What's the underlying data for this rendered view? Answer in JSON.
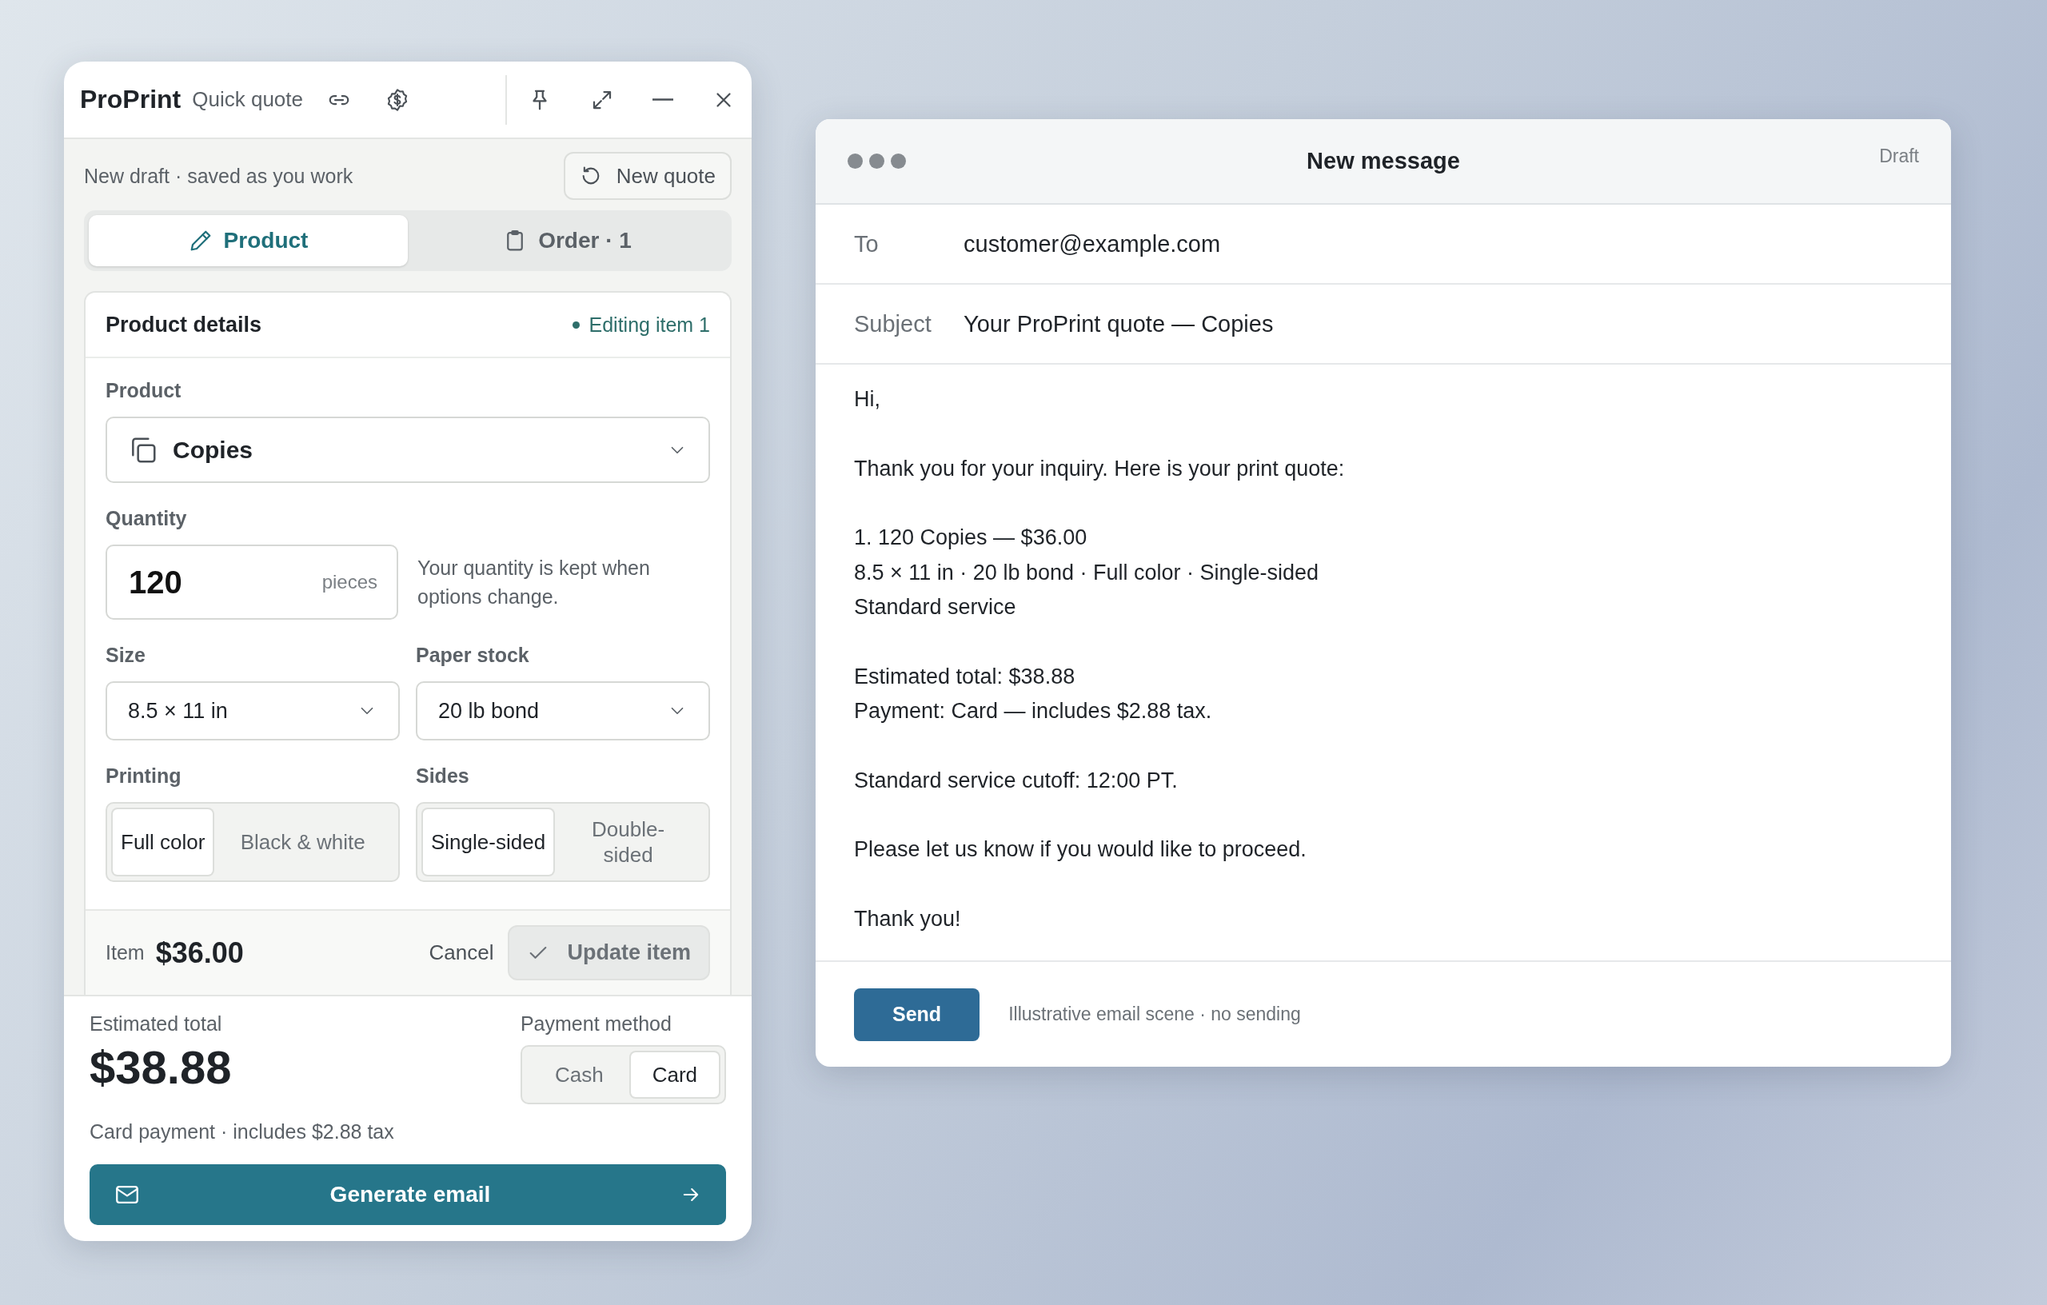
{
  "quote_panel": {
    "title": "ProPrint",
    "subtitle": "Quick quote",
    "status": "New draft · saved as you work",
    "new_quote_button": "New quote",
    "tabs": [
      {
        "label": "Product",
        "selected": true
      },
      {
        "label": "Order · 1",
        "selected": false
      }
    ],
    "card": {
      "title": "Product details",
      "editing": "Editing item 1",
      "product": {
        "label": "Product",
        "value": "Copies"
      },
      "quantity": {
        "label": "Quantity",
        "value": "120",
        "unit": "pieces",
        "hint": "Your quantity is kept when options change."
      },
      "size": {
        "label": "Size",
        "value": "8.5 × 11 in"
      },
      "paper": {
        "label": "Paper stock",
        "value": "20 lb bond"
      },
      "printing": {
        "label": "Printing",
        "options": [
          {
            "label": "Full color",
            "selected": true
          },
          {
            "label": "Black & white",
            "selected": false
          }
        ]
      },
      "sides": {
        "label": "Sides",
        "options": [
          {
            "label": "Single-sided",
            "selected": true
          },
          {
            "label": "Double-sided",
            "selected": false
          }
        ]
      },
      "item_label": "Item",
      "item_price": "$36.00",
      "cancel": "Cancel",
      "update": {
        "label": "Update item",
        "disabled": true
      }
    },
    "total_label": "Estimated total",
    "total": "$38.88",
    "payment": {
      "label": "Payment method",
      "options": [
        {
          "label": "Cash",
          "selected": false
        },
        {
          "label": "Card",
          "selected": true
        }
      ]
    },
    "note": "Card payment · includes $2.88 tax",
    "generate_button": "Generate email"
  },
  "email": {
    "title": "New message",
    "badge": "Draft",
    "to_label": "To",
    "to": "customer@example.com",
    "subject_label": "Subject",
    "subject": "Your ProPrint quote — Copies",
    "paragraphs": [
      [
        "Hi,"
      ],
      [
        "Thank you for your inquiry. Here is your print quote:"
      ],
      [
        "1. 120 Copies — $36.00",
        "8.5 × 11 in · 20 lb bond · Full color · Single-sided",
        "Standard service"
      ],
      [
        "Estimated total: $38.88",
        "Payment: Card — includes $2.88 tax."
      ],
      [
        "Standard service cutoff: 12:00 PT."
      ],
      [
        "Please let us know if you would like to proceed."
      ],
      [
        "Thank you!"
      ]
    ],
    "send": "Send",
    "footer_note": "Illustrative email scene · no sending"
  }
}
